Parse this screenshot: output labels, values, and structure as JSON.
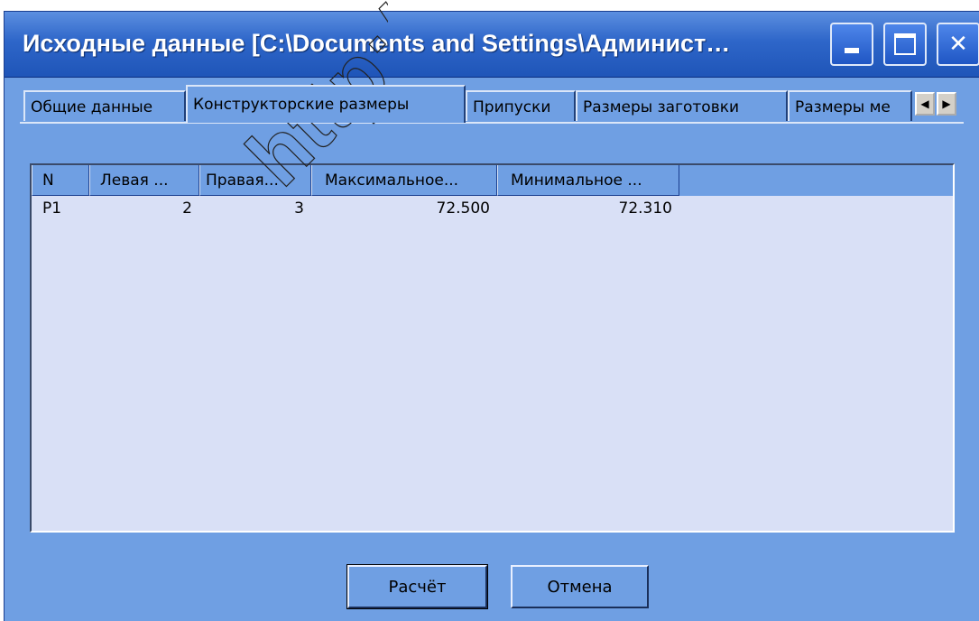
{
  "window": {
    "title": "Исходные данные [C:\\Documents and Settings\\Админист…",
    "controls": {
      "minimize_icon": "minimize-icon",
      "maximize_icon": "maximize-icon",
      "close_icon": "close-icon"
    }
  },
  "tabs": {
    "items": [
      {
        "label": "Общие данные"
      },
      {
        "label": "Конструкторские размеры"
      },
      {
        "label": "Припуски"
      },
      {
        "label": "Размеры заготовки"
      },
      {
        "label": "Размеры ме"
      }
    ],
    "active_index": 1
  },
  "grid": {
    "columns": [
      "N",
      "Левая ...",
      "Правая...",
      "Максимальное...",
      "Минимальное ..."
    ],
    "rows": [
      [
        "P1",
        "2",
        "3",
        "72.500",
        "72.310"
      ]
    ]
  },
  "buttons": {
    "calc": "Расчёт",
    "cancel": "Отмена"
  },
  "watermark": {
    "text": "http://"
  },
  "colors": {
    "window_bg": "#6f9fe3",
    "titlebar": "#2e66c9",
    "grid_bg": "#d9e0f6"
  }
}
